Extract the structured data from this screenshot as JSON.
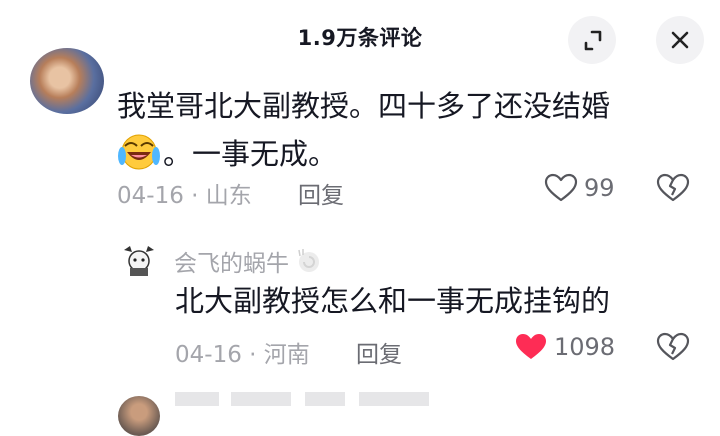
{
  "header": {
    "title": "1.9万条评论",
    "expand_icon": "collapse-expand-icon",
    "close_icon": "close-icon"
  },
  "comments": [
    {
      "author": "",
      "text_line1": "我堂哥北大副教授。四十多了还没结婚",
      "text_line2": "。一事无成。",
      "emoji": "laughing-crying-emoji",
      "date": "04-16",
      "separator": "·",
      "location": "山东",
      "reply_label": "回复",
      "likes": "99",
      "liked": false,
      "replies": [
        {
          "author": "会飞的蜗牛",
          "author_suffix_icon": "snail-shell-badge-icon",
          "text": "北大副教授怎么和一事无成挂钩的",
          "date": "04-16",
          "separator": "·",
          "location": "河南",
          "reply_label": "回复",
          "likes": "1098",
          "liked": true
        }
      ]
    }
  ],
  "colors": {
    "text": "#161823",
    "muted": "#a4a5ab",
    "like_active": "#fe2c55",
    "button_bg": "#f2f2f4"
  }
}
